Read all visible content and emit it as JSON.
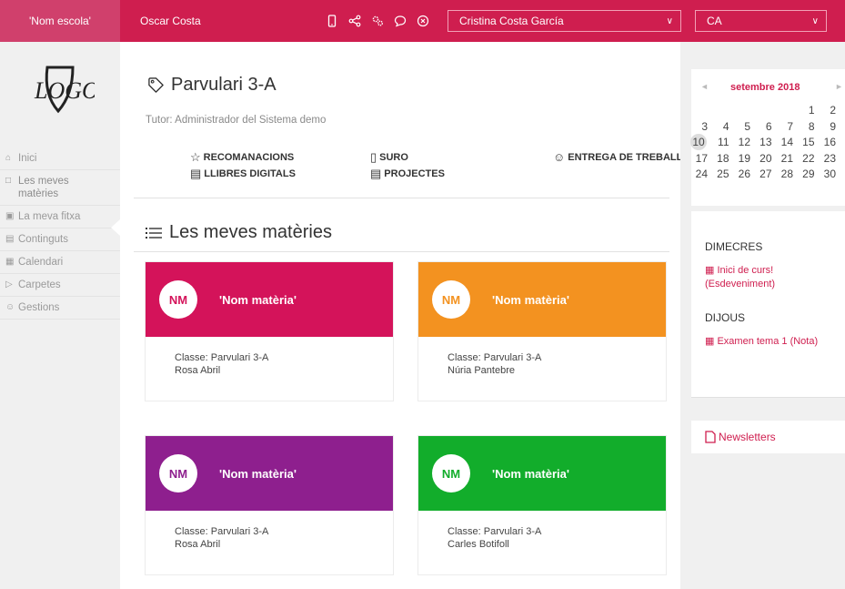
{
  "topbar": {
    "school": "'Nom escola'",
    "user_name": "Oscar Costa",
    "student_select": "Cristina Costa García",
    "language_select": "CA"
  },
  "sidebar": {
    "items": [
      {
        "label": "Inici"
      },
      {
        "label": "Les meves matèries"
      },
      {
        "label": "La meva fitxa"
      },
      {
        "label": "Continguts"
      },
      {
        "label": "Calendari"
      },
      {
        "label": "Carpetes"
      },
      {
        "label": "Gestions"
      }
    ]
  },
  "main": {
    "class_title": "Parvulari 3-A",
    "tutor": "Tutor: Administrador del Sistema demo",
    "links": {
      "recomanacions": "RECOMANACIONS",
      "suro": "SURO",
      "entrega": "ENTREGA DE TREBALLS",
      "llibres": "LLIBRES DIGITALS",
      "projectes": "PROJECTES"
    },
    "section_title": "Les meves matèries",
    "class_label": "Classe:",
    "cards": [
      {
        "initials": "NM",
        "subject": "'Nom matèria'",
        "classe": "Parvulari 3-A",
        "teacher": "Rosa Abril",
        "color": "#d4135a"
      },
      {
        "initials": "NM",
        "subject": "'Nom matèria'",
        "classe": "Parvulari 3-A",
        "teacher": "Núria Pantebre",
        "color": "#f39220"
      },
      {
        "initials": "NM",
        "subject": "'Nom matèria'",
        "classe": "Parvulari 3-A",
        "teacher": "Rosa Abril",
        "color": "#8e1f8e"
      },
      {
        "initials": "NM",
        "subject": "'Nom matèria'",
        "classe": "Parvulari 3-A",
        "teacher": "Carles Botifoll",
        "color": "#12ad2b"
      }
    ]
  },
  "calendar": {
    "prev": "◄",
    "next": "►",
    "month": "setembre 2018",
    "today": "10",
    "weeks": [
      [
        "",
        "",
        "",
        "",
        "",
        "1",
        "2"
      ],
      [
        "3",
        "4",
        "5",
        "6",
        "7",
        "8",
        "9"
      ],
      [
        "10",
        "11",
        "12",
        "13",
        "14",
        "15",
        "16"
      ],
      [
        "17",
        "18",
        "19",
        "20",
        "21",
        "22",
        "23"
      ],
      [
        "24",
        "25",
        "26",
        "27",
        "28",
        "29",
        "30"
      ]
    ]
  },
  "events": {
    "day1": "DIMECRES",
    "event1": "Inici de curs! (Esdeveniment)",
    "day2": "DIJOUS",
    "event2": "Examen tema 1 (Nota)"
  },
  "newsletters": "Newsletters",
  "colors": {
    "accent": "#cf1e4f"
  }
}
